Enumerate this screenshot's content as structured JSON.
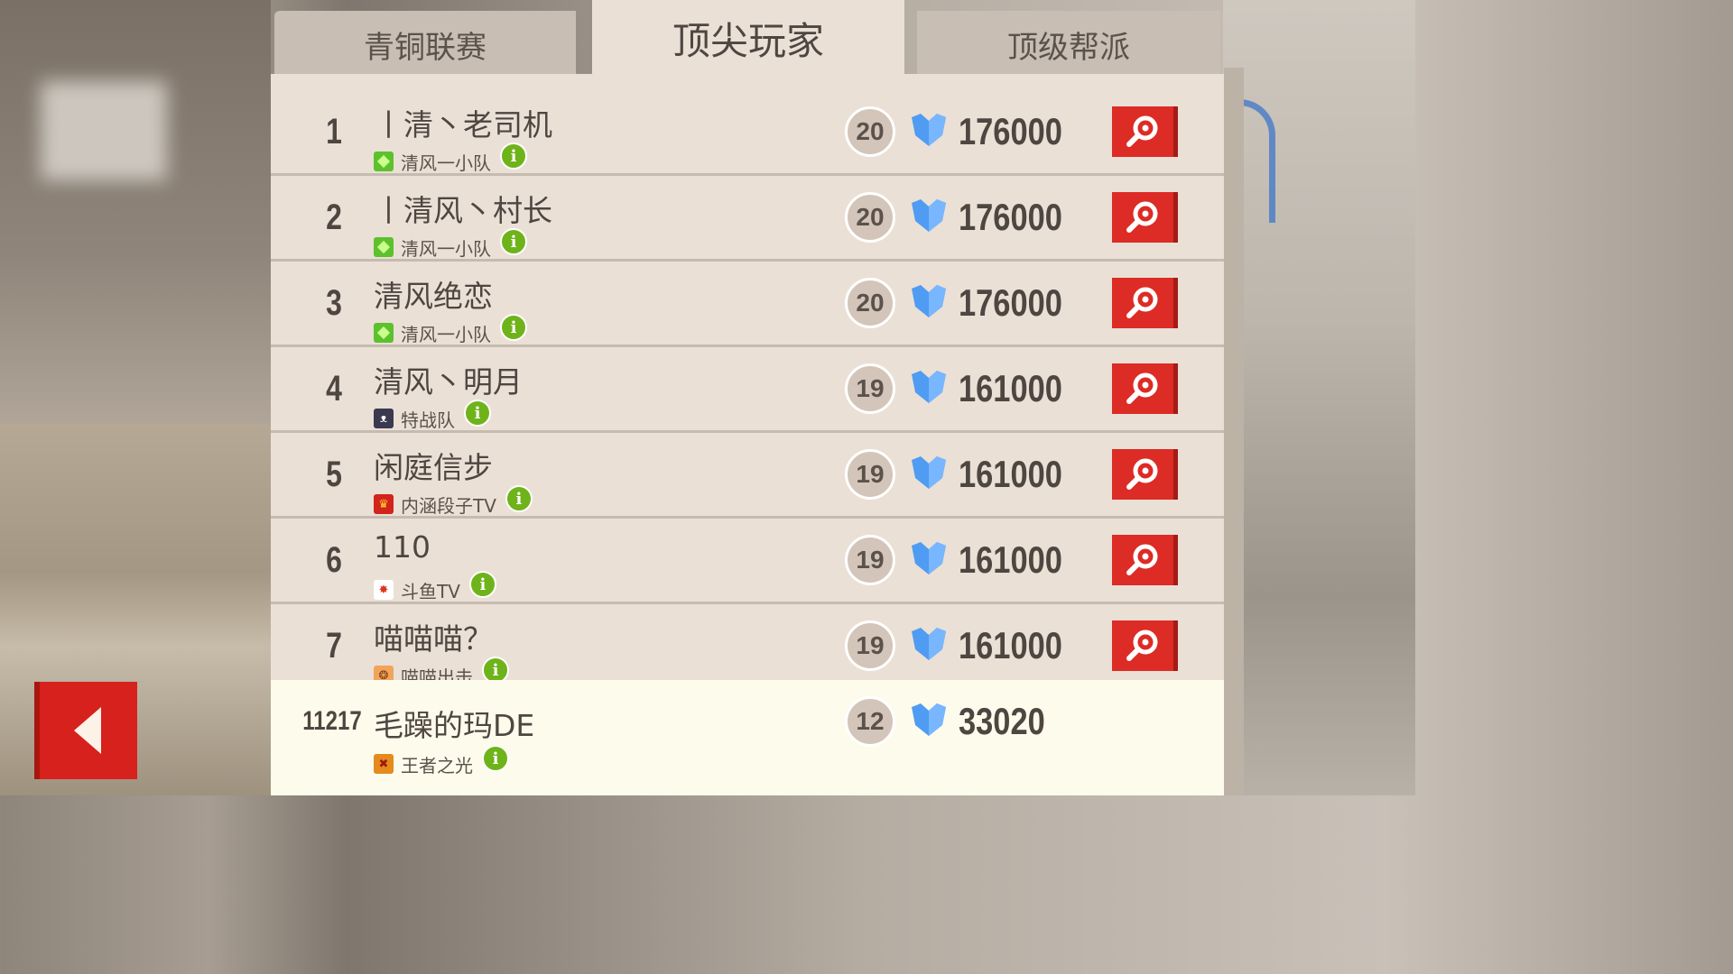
{
  "tabs": {
    "left": "青铜联赛",
    "active": "顶尖玩家",
    "right": "顶级帮派"
  },
  "players": [
    {
      "rank": "1",
      "name": "丨清丶老司机",
      "guild": "清风一小队",
      "guild_icon": "green-gem-icon",
      "level": "20",
      "score": "176000"
    },
    {
      "rank": "2",
      "name": "丨清风丶村长",
      "guild": "清风一小队",
      "guild_icon": "green-gem-icon",
      "level": "20",
      "score": "176000"
    },
    {
      "rank": "3",
      "name": "清风绝恋",
      "guild": "清风一小队",
      "guild_icon": "green-gem-icon",
      "level": "20",
      "score": "176000"
    },
    {
      "rank": "4",
      "name": "清风丶明月",
      "guild": "特战队",
      "guild_icon": "monster-face-icon",
      "level": "19",
      "score": "161000"
    },
    {
      "rank": "5",
      "name": "闲庭信步",
      "guild": "内涵段子TV",
      "guild_icon": "crown-icon",
      "level": "19",
      "score": "161000"
    },
    {
      "rank": "6",
      "name": "110",
      "guild": "斗鱼TV",
      "guild_icon": "star-burst-icon",
      "level": "19",
      "score": "161000"
    },
    {
      "rank": "7",
      "name": "喵喵喵？",
      "guild": "喵喵出击",
      "guild_icon": "paw-icon",
      "level": "19",
      "score": "161000"
    }
  ],
  "me": {
    "rank": "11217",
    "name": "毛躁的玛DE",
    "guild": "王者之光",
    "guild_icon": "cross-swords-icon",
    "level": "12",
    "score": "33020"
  },
  "info_glyph": "i",
  "colors": {
    "accent_red": "#dd2b25",
    "trophy_blue": "#4f9cf2",
    "info_green": "#6fb31a",
    "panel": "#eae0d6",
    "me_row": "#fdfbec"
  }
}
